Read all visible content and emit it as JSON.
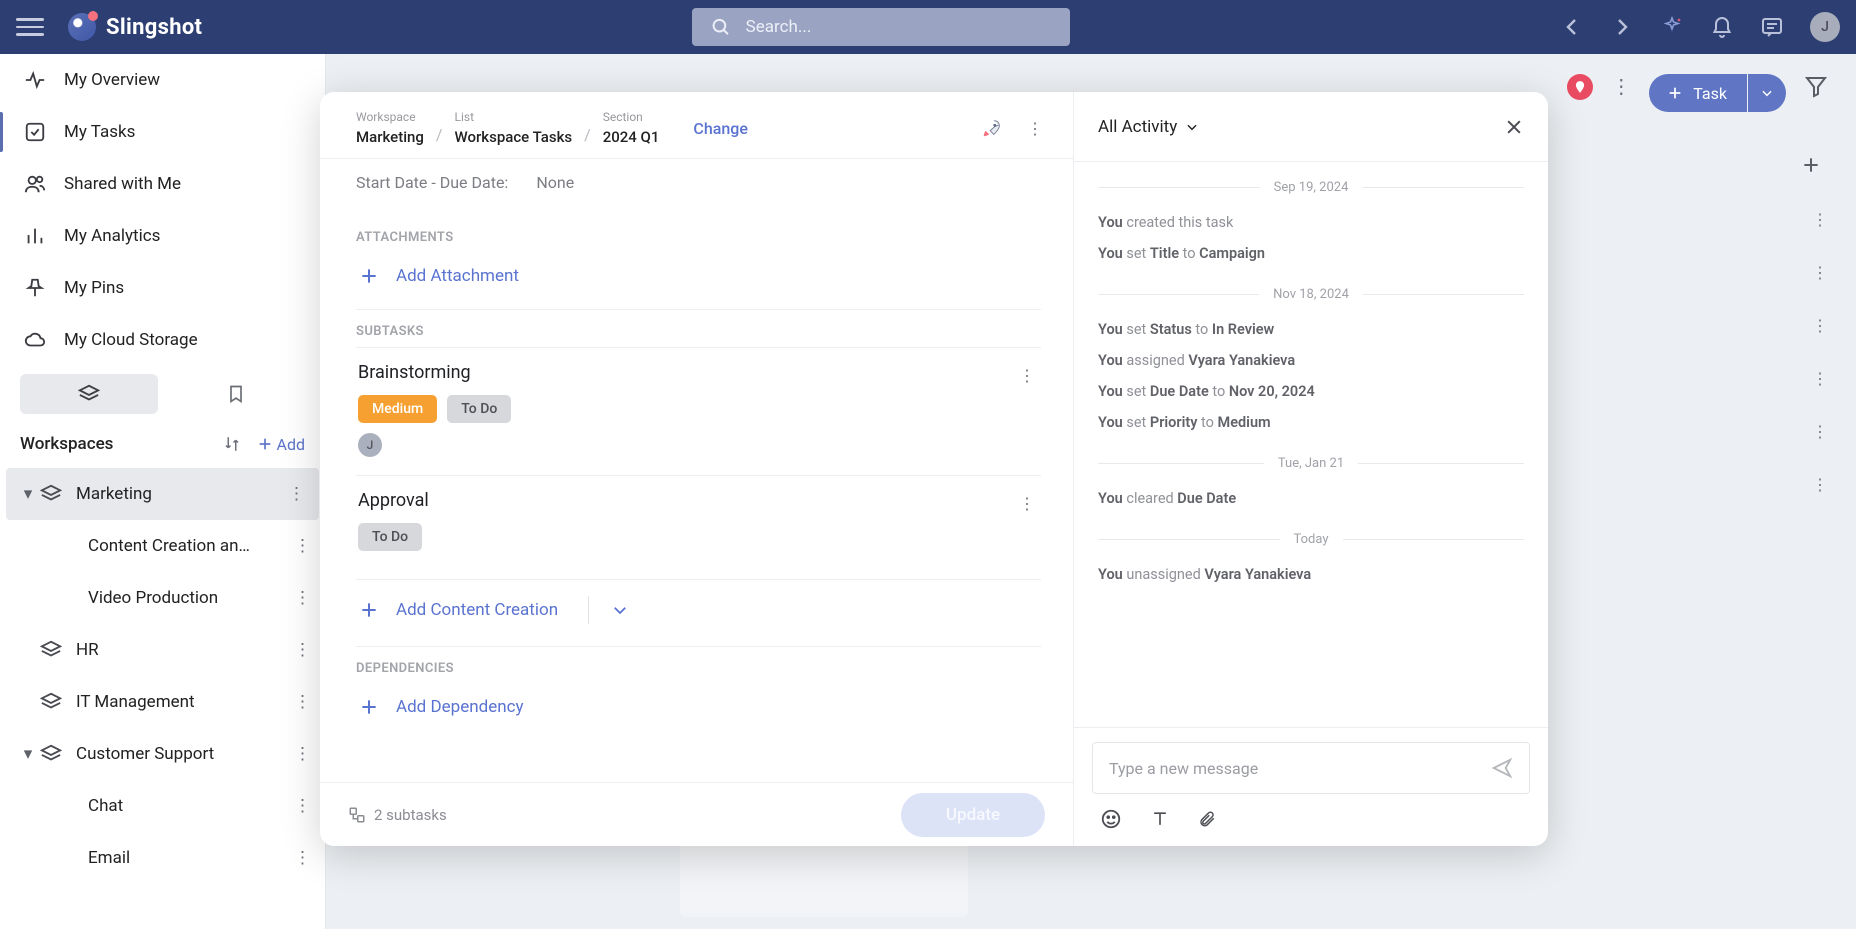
{
  "app": {
    "name": "Slingshot"
  },
  "search": {
    "placeholder": "Search..."
  },
  "user": {
    "initial": "J"
  },
  "nav": {
    "overview": "My Overview",
    "tasks": "My Tasks",
    "shared": "Shared with Me",
    "analytics": "My Analytics",
    "pins": "My Pins",
    "cloud": "My Cloud Storage"
  },
  "workspaces": {
    "title": "Workspaces",
    "add": "Add",
    "items": [
      {
        "name": "Marketing",
        "children": [
          "Content Creation an…",
          "Video Production"
        ]
      },
      {
        "name": "HR"
      },
      {
        "name": "IT Management"
      },
      {
        "name": "Customer Support",
        "children": [
          "Chat",
          "Email"
        ]
      }
    ]
  },
  "mainbar": {
    "task_btn": "Task"
  },
  "modal": {
    "breadcrumbs": {
      "workspace_lbl": "Workspace",
      "workspace": "Marketing",
      "list_lbl": "List",
      "list": "Workspace Tasks",
      "section_lbl": "Section",
      "section": "2024 Q1"
    },
    "change": "Change",
    "date_label": "Start Date - Due Date:",
    "date_value": "None",
    "attachments_lbl": "ATTACHMENTS",
    "add_attachment": "Add Attachment",
    "subtasks_lbl": "SUBTASKS",
    "subtasks": [
      {
        "title": "Brainstorming",
        "priority": "Medium",
        "status": "To Do",
        "assignee_initial": "J"
      },
      {
        "title": "Approval",
        "status": "To Do"
      }
    ],
    "add_subtask": "Add Content Creation",
    "dependencies_lbl": "DEPENDENCIES",
    "add_dependency": "Add Dependency",
    "subtask_count": "2 subtasks",
    "update_btn": "Update"
  },
  "activity": {
    "title": "All Activity",
    "groups": [
      {
        "date": "Sep 19, 2024",
        "lines": [
          {
            "pre": "You ",
            "act": "created this task"
          },
          {
            "pre": "You ",
            "mid1": "set ",
            "b1": "Title",
            "mid2": " to ",
            "b2": "Campaign"
          }
        ]
      },
      {
        "date": "Nov 18, 2024",
        "lines": [
          {
            "pre": "You ",
            "mid1": "set ",
            "b1": "Status",
            "mid2": " to ",
            "b2": "In Review"
          },
          {
            "pre": "You ",
            "mid1": "assigned ",
            "b1": "Vyara Yanakieva"
          },
          {
            "pre": "You ",
            "mid1": "set ",
            "b1": "Due Date",
            "mid2": " to ",
            "b2": "Nov 20, 2024"
          },
          {
            "pre": "You ",
            "mid1": "set ",
            "b1": "Priority",
            "mid2": " to ",
            "b2": "Medium"
          }
        ]
      },
      {
        "date": "Tue, Jan 21",
        "lines": [
          {
            "pre": "You ",
            "mid1": "cleared ",
            "b1": "Due Date"
          }
        ]
      },
      {
        "date": "Today",
        "lines": [
          {
            "pre": "You ",
            "mid1": "unassigned ",
            "b1": "Vyara Yanakieva"
          }
        ]
      }
    ],
    "compose_placeholder": "Type a new message"
  }
}
